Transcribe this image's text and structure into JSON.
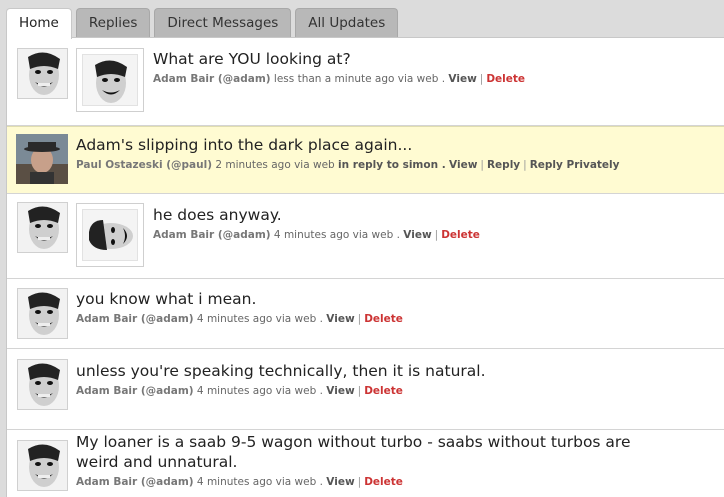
{
  "tabs": [
    {
      "label": "Home",
      "active": true
    },
    {
      "label": "Replies",
      "active": false
    },
    {
      "label": "Direct Messages",
      "active": false
    },
    {
      "label": "All Updates",
      "active": false
    }
  ],
  "help_icon": "?",
  "statuses": [
    {
      "text": "What are YOU looking at?",
      "author": "Adam Bair (@adam)",
      "time": "less than a minute ago via web .",
      "actions": [
        "View",
        "Delete"
      ],
      "has_thumb": true
    },
    {
      "text": "Adam's slipping into the dark place again...",
      "author": "Paul Ostazeski (@paul)",
      "time": "2 minutes ago via web",
      "reply_to": "in reply to simon .",
      "actions": [
        "View",
        "Reply",
        "Reply Privately"
      ],
      "highlighted": true
    },
    {
      "text": "he does anyway.",
      "author": "Adam Bair (@adam)",
      "time": "4 minutes ago via web .",
      "actions": [
        "View",
        "Delete"
      ],
      "has_thumb": true
    },
    {
      "text": "you know what i mean.",
      "author": "Adam Bair (@adam)",
      "time": "4 minutes ago via web .",
      "actions": [
        "View",
        "Delete"
      ]
    },
    {
      "text": "unless you're speaking technically, then it is natural.",
      "author": "Adam Bair (@adam)",
      "time": "4 minutes ago via web .",
      "actions": [
        "View",
        "Delete"
      ]
    },
    {
      "text": "My loaner is a saab 9-5 wagon without turbo - saabs without turbos are weird and unnatural.",
      "author": "Adam Bair (@adam)",
      "time": "4 minutes ago via web .",
      "actions": [
        "View",
        "Delete"
      ]
    }
  ]
}
